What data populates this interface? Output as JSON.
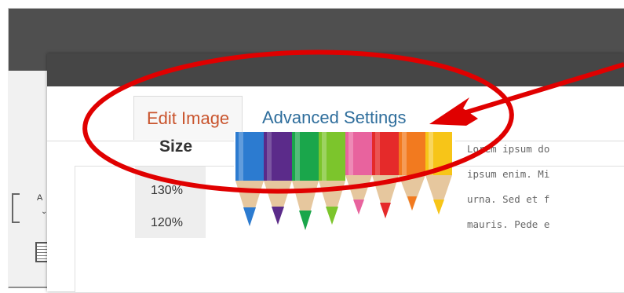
{
  "dialog": {
    "tabs": [
      {
        "label": "Edit Image",
        "active": true
      },
      {
        "label": "Advanced Settings",
        "active": false
      }
    ]
  },
  "image_editor": {
    "size_heading": "Size",
    "size_options": [
      "130%",
      "120%"
    ]
  },
  "preview_text_lines": [
    "Lorem ipsum do",
    "ipsum enim. Mi",
    "urna. Sed et f",
    "mauris. Pede e"
  ],
  "toolbar": {
    "align_label": "A"
  },
  "colors": {
    "active_tab_text": "#c9542d",
    "inactive_tab_text": "#2f6e9c",
    "annotation_red": "#e00000",
    "modal_header": "#464646"
  }
}
